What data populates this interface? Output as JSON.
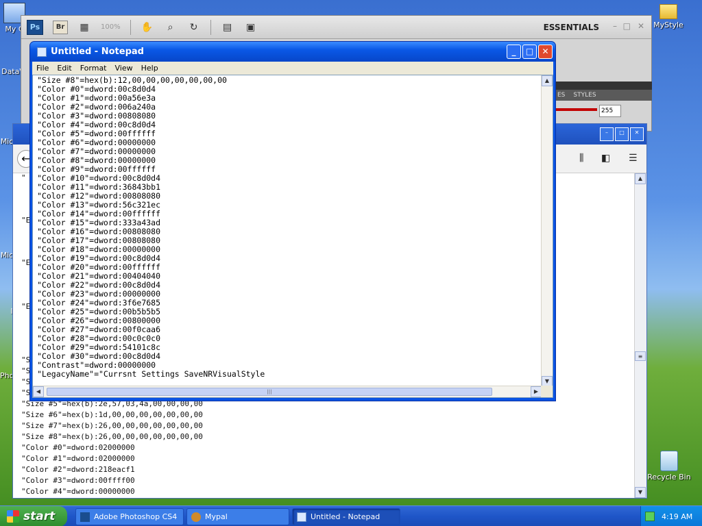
{
  "desktop": {
    "icons": [
      {
        "label": "My C"
      },
      {
        "label": "DataV"
      },
      {
        "label": "Mic"
      },
      {
        "label": "Mic"
      },
      {
        "label": "I"
      },
      {
        "label": "Pho"
      },
      {
        "label": "MyStyle"
      },
      {
        "label": "Recycle Bin"
      }
    ]
  },
  "photoshop": {
    "logo": "Ps",
    "bridge_logo": "Br",
    "zoom": "100%",
    "workspace": "ESSENTIALS",
    "panel_tabs": [
      "ES",
      "STYLES"
    ],
    "slider_value": "255"
  },
  "notepad": {
    "title": "Untitled - Notepad",
    "menu": [
      "File",
      "Edit",
      "Format",
      "View",
      "Help"
    ],
    "lines": [
      "\"Size #8\"=hex(b):12,00,00,00,00,00,00,00",
      "\"Color #0\"=dword:00c8d0d4",
      "\"Color #1\"=dword:00a56e3a",
      "\"Color #2\"=dword:006a240a",
      "\"Color #3\"=dword:00808080",
      "\"Color #4\"=dword:00c8d0d4",
      "\"Color #5\"=dword:00ffffff",
      "\"Color #6\"=dword:00000000",
      "\"Color #7\"=dword:00000000",
      "\"Color #8\"=dword:00000000",
      "\"Color #9\"=dword:00ffffff",
      "\"Color #10\"=dword:00c8d0d4",
      "\"Color #11\"=dword:36843bb1",
      "\"Color #12\"=dword:00808080",
      "\"Color #13\"=dword:56c321ec",
      "\"Color #14\"=dword:00ffffff",
      "\"Color #15\"=dword:333a43ad",
      "\"Color #16\"=dword:00808080",
      "\"Color #17\"=dword:00808080",
      "\"Color #18\"=dword:00000000",
      "\"Color #19\"=dword:00c8d0d4",
      "\"Color #20\"=dword:00ffffff",
      "\"Color #21\"=dword:00404040",
      "\"Color #22\"=dword:00c8d0d4",
      "\"Color #23\"=dword:00000000",
      "\"Color #24\"=dword:3f6e7685",
      "\"Color #25\"=dword:00b5b5b5",
      "\"Color #26\"=dword:00800000",
      "\"Color #27\"=dword:00f0caa6",
      "\"Color #28\"=dword:00c0c0c0",
      "\"Color #29\"=dword:54101c8c",
      "\"Color #30\"=dword:00c8d0d4",
      "\"Contrast\"=dword:00000000",
      "\"LegacyName\"=\"Currsnt Settings SaveNRVisualStyle"
    ]
  },
  "background_window": {
    "partial_lines": [
      "\"",
      "\"E",
      "\"E",
      "\"E",
      "\"S",
      "\"S",
      "\"S",
      "\"S"
    ],
    "lines": [
      "\"Size #5\"=hex(b):2e,57,03,4a,00,00,00,00",
      "\"Size #6\"=hex(b):1d,00,00,00,00,00,00,00",
      "\"Size #7\"=hex(b):26,00,00,00,00,00,00,00",
      "\"Size #8\"=hex(b):26,00,00,00,00,00,00,00",
      "\"Color #0\"=dword:02000000",
      "\"Color #1\"=dword:02000000",
      "\"Color #2\"=dword:218eacf1",
      "\"Color #3\"=dword:00ffff00",
      "\"Color #4\"=dword:00000000"
    ]
  },
  "taskbar": {
    "start_label": "start",
    "tasks": [
      {
        "label": "Adobe Photoshop CS4"
      },
      {
        "label": "Mypal"
      },
      {
        "label": "Untitled - Notepad"
      }
    ],
    "clock": "4:19 AM"
  }
}
